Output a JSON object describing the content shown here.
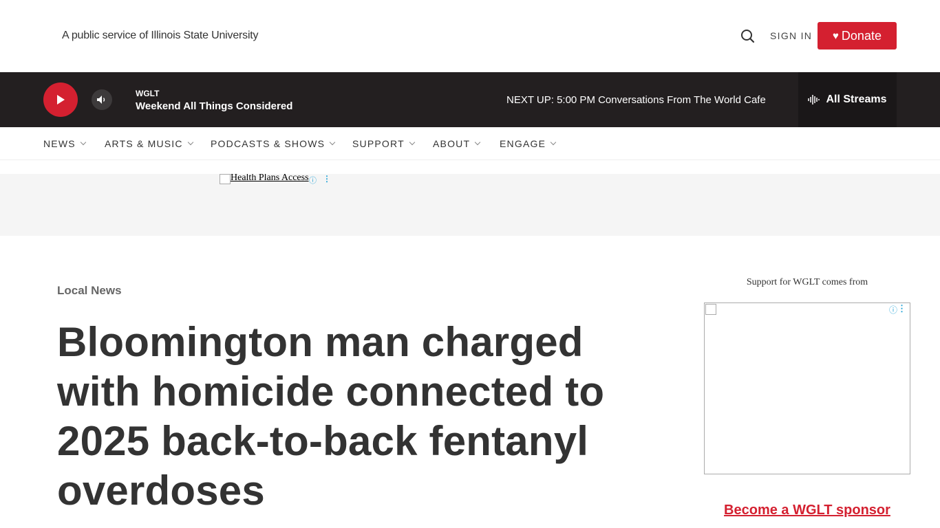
{
  "header": {
    "tagline": "A public service of Illinois State University",
    "sign_in": "SIGN IN",
    "donate": "Donate"
  },
  "player": {
    "station": "WGLT",
    "program": "Weekend All Things Considered",
    "next_up": "NEXT UP: 5:00 PM Conversations From The World Cafe",
    "streams": "All Streams"
  },
  "nav": {
    "items": [
      "NEWS",
      "ARTS & MUSIC",
      "PODCASTS & SHOWS",
      "SUPPORT",
      "ABOUT",
      "ENGAGE"
    ]
  },
  "ad_banner": {
    "alt_text": "Health Plans Access"
  },
  "article": {
    "category": "Local News",
    "headline": "Bloomington man charged with homicide connected to 2025 back-to-back fentanyl overdoses"
  },
  "sidebar": {
    "support_text": "Support for WGLT comes from",
    "sponsor_link": "Become a WGLT sponsor"
  },
  "colors": {
    "brand_red": "#d42030",
    "player_bg": "#231f20",
    "ad_info": "#2aa6d8"
  }
}
